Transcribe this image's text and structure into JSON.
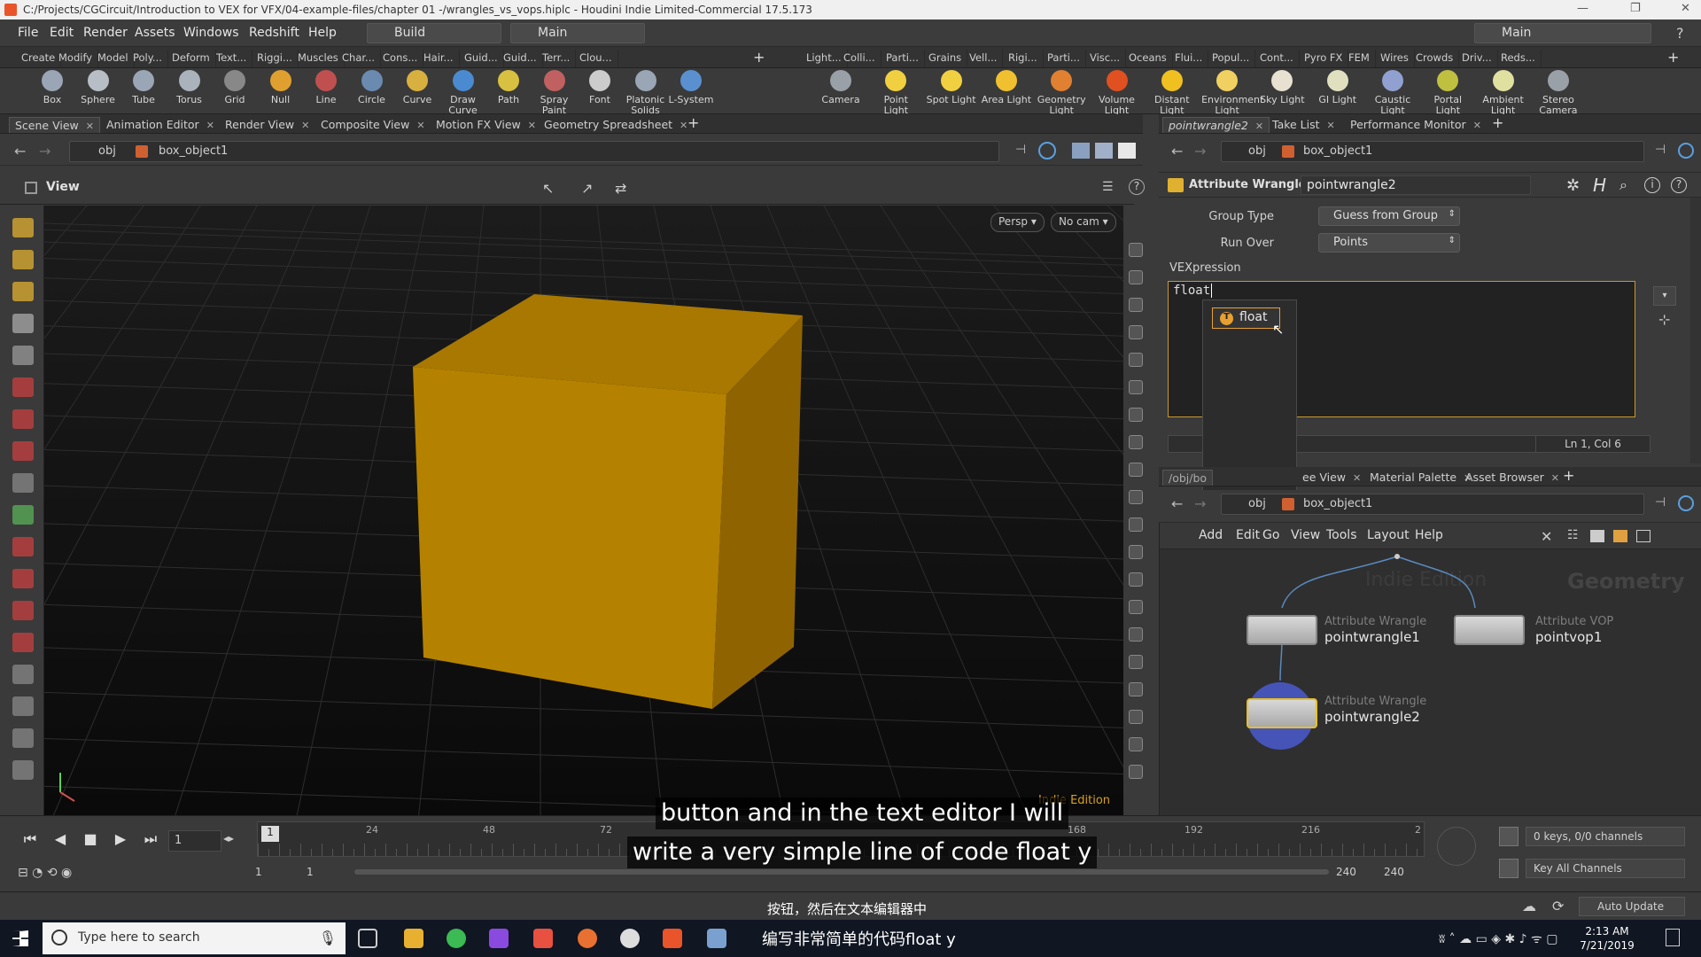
{
  "window": {
    "title": "C:/Projects/CGCircuit/Introduction to VEX for VFX/04-example-files/chapter 01 -/wrangles_vs_vops.hiplc - Houdini Indie Limited-Commercial 17.5.173"
  },
  "menubar": {
    "items": [
      "File",
      "Edit",
      "Render",
      "Assets",
      "Windows",
      "Redshift",
      "Help"
    ],
    "desktop_combo": "Build",
    "context_combo": "Main",
    "right_desktop": "Main"
  },
  "shelf_tabs_left": [
    "Create",
    "Modify",
    "Model",
    "Poly...",
    "Deform",
    "Text...",
    "Riggi...",
    "Muscles",
    "Char...",
    "Cons...",
    "Hair...",
    "Guid...",
    "Guid...",
    "Terr...",
    "Clou..."
  ],
  "shelf_tabs_right": [
    "Light...",
    "Colli...",
    "Parti...",
    "Grains",
    "Vell...",
    "Rigi...",
    "Parti...",
    "Visc...",
    "Oceans",
    "Flui...",
    "Popul...",
    "Cont...",
    "Pyro FX",
    "FEM",
    "Wires",
    "Crowds",
    "Driv...",
    "Reds..."
  ],
  "shelf_tools_left": [
    {
      "label": "Box",
      "color": "#9aa6b5"
    },
    {
      "label": "Sphere",
      "color": "#b8bec6"
    },
    {
      "label": "Tube",
      "color": "#9aa6b5"
    },
    {
      "label": "Torus",
      "color": "#aab2bb"
    },
    {
      "label": "Grid",
      "color": "#888"
    },
    {
      "label": "Null",
      "color": "#e0a030"
    },
    {
      "label": "Line",
      "color": "#c05050"
    },
    {
      "label": "Circle",
      "color": "#6a8ab0"
    },
    {
      "label": "Curve",
      "color": "#d8b040"
    },
    {
      "label": "Draw Curve",
      "color": "#4a8ad0"
    },
    {
      "label": "Path",
      "color": "#d8c040"
    },
    {
      "label": "Spray Paint",
      "color": "#c06060"
    },
    {
      "label": "Font",
      "color": "#cccccc"
    },
    {
      "label": "Platonic Solids",
      "color": "#9aa6b5"
    },
    {
      "label": "L-System",
      "color": "#5a90d0"
    }
  ],
  "shelf_tools_right": [
    {
      "label": "Camera",
      "color": "#9aa0a8"
    },
    {
      "label": "Point Light",
      "color": "#f0d040"
    },
    {
      "label": "Spot Light",
      "color": "#f0d040"
    },
    {
      "label": "Area Light",
      "color": "#f0c030"
    },
    {
      "label": "Geometry Light",
      "color": "#e08030"
    },
    {
      "label": "Volume Light",
      "color": "#e05020"
    },
    {
      "label": "Distant Light",
      "color": "#f0c020"
    },
    {
      "label": "Environment Light",
      "color": "#f0d060"
    },
    {
      "label": "Sky Light",
      "color": "#e8e0d0"
    },
    {
      "label": "GI Light",
      "color": "#e0e0c0"
    },
    {
      "label": "Caustic Light",
      "color": "#90a0d0"
    },
    {
      "label": "Portal Light",
      "color": "#c0c040"
    },
    {
      "label": "Ambient Light",
      "color": "#e0e0a0"
    },
    {
      "label": "Stereo Camera",
      "color": "#9aa0a8"
    }
  ],
  "left_pane_tabs": [
    "Scene View",
    "Animation Editor",
    "Render View",
    "Composite View",
    "Motion FX View",
    "Geometry Spreadsheet"
  ],
  "right_pane_tabs": [
    "pointwrangle2",
    "Take List",
    "Performance Monitor"
  ],
  "path": {
    "root": "obj",
    "object": "box_object1"
  },
  "viewport": {
    "label": "View",
    "persp": "Persp",
    "cam": "No cam",
    "edition": "Indie Edition"
  },
  "params": {
    "node_type": "Attribute Wrangle",
    "node_name": "pointwrangle2",
    "group_type_label": "Group Type",
    "group_type_value": "Guess from Group",
    "run_over_label": "Run Over",
    "run_over_value": "Points",
    "vex_label": "VEXpression",
    "vex_code": "float",
    "autocomplete": "float",
    "cursor_pos": "Ln 1, Col 6"
  },
  "network_tabs": {
    "path_prefix": "/obj/bo",
    "tabs": [
      "ee View",
      "Material Palette",
      "Asset Browser"
    ]
  },
  "network_menu": [
    "Add",
    "Edit",
    "Go",
    "View",
    "Tools",
    "Layout",
    "Help"
  ],
  "network": {
    "watermark_edition": "Indie Edition",
    "watermark_context": "Geometry",
    "nodes": [
      {
        "type": "Attribute Wrangle",
        "name": "pointwrangle1"
      },
      {
        "type": "Attribute VOP",
        "name": "pointvop1"
      },
      {
        "type": "Attribute Wrangle",
        "name": "pointwrangle2"
      }
    ]
  },
  "timeline": {
    "current_frame": "1",
    "ticks": [
      "24",
      "48",
      "72",
      "168",
      "192",
      "216",
      "2"
    ],
    "start": "1",
    "start2": "1",
    "end": "240",
    "end2": "240",
    "keys": "0 keys, 0/0 channels",
    "key_all": "Key All Channels",
    "auto_update": "Auto Update",
    "frame_marker": "1"
  },
  "subtitles": {
    "line1": "button and in the text editor I will",
    "line2": "write a very simple line of code float y",
    "cn1": "按钮，然后在文本编辑器中",
    "cn2": "编写非常简单的代码float y"
  },
  "taskbar": {
    "search_placeholder": "Type here to search",
    "time": "2:13 AM",
    "date": "7/21/2019"
  }
}
